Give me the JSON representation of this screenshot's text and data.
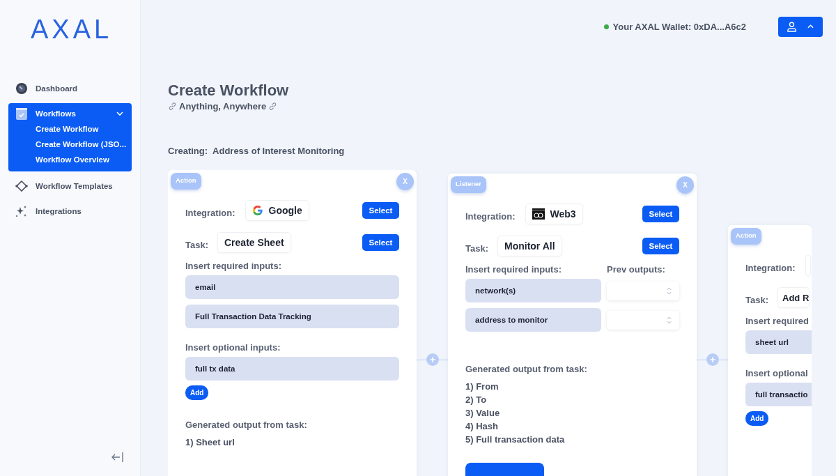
{
  "sidebar": {
    "logo": "AXAL",
    "items": [
      {
        "label": "Dashboard",
        "selected": false
      },
      {
        "label": "Workflows",
        "selected": true,
        "expanded": true,
        "children": [
          {
            "label": "Create Workflow"
          },
          {
            "label": "Create Workflow (JSO..."
          },
          {
            "label": "Workflow Overview"
          }
        ]
      },
      {
        "label": "Workflow Templates",
        "selected": false
      },
      {
        "label": "Integrations",
        "selected": false
      }
    ]
  },
  "header": {
    "wallet": {
      "connected": true,
      "label": "Your AXAL Wallet: 0xDA...A6c2"
    }
  },
  "page": {
    "title": "Create Workflow",
    "subtitle": "Anything, Anywhere",
    "creating_label": "Creating:",
    "creating_name": "Address of Interest Monitoring"
  },
  "cards": [
    {
      "kind": "action",
      "badge": "Action",
      "close": "X",
      "integration_label": "Integration:",
      "integration": {
        "name": "Google"
      },
      "integration_select": "Select",
      "task_label": "Task:",
      "task": "Create Sheet",
      "task_select": "Select",
      "required_label": "Insert required inputs:",
      "required_inputs": [
        {
          "value": "email"
        },
        {
          "value": "Full Transaction Data Tracking"
        }
      ],
      "optional_label": "Insert optional inputs:",
      "optional_inputs": [
        {
          "value": "full tx data"
        }
      ],
      "add_label": "Add",
      "output_label": "Generated output from task:",
      "outputs": [
        "1) Sheet url"
      ]
    },
    {
      "kind": "listener",
      "badge": "Listener",
      "close": "X",
      "integration_label": "Integration:",
      "integration": {
        "name": "Web3"
      },
      "integration_select": "Select",
      "task_label": "Task:",
      "task": "Monitor All",
      "task_select": "Select",
      "required_label": "Insert required inputs:",
      "prev_label": "Prev outputs:",
      "required_inputs": [
        {
          "value": "network(s)"
        },
        {
          "value": "address to monitor"
        }
      ],
      "output_label": "Generated output from task:",
      "outputs": [
        "1) From",
        "2) To",
        "3) Value",
        "4) Hash",
        "5) Full transaction data"
      ],
      "footer_button": true
    },
    {
      "kind": "action",
      "badge": "Action",
      "integration_label": "Integration:",
      "task_label": "Task:",
      "task": "Add R",
      "required_label": "Insert required",
      "required_inputs": [
        {
          "value": "sheet url"
        }
      ],
      "optional_label": "Insert optional",
      "optional_inputs": [
        {
          "value": "full transactio"
        }
      ],
      "add_label": "Add"
    }
  ]
}
